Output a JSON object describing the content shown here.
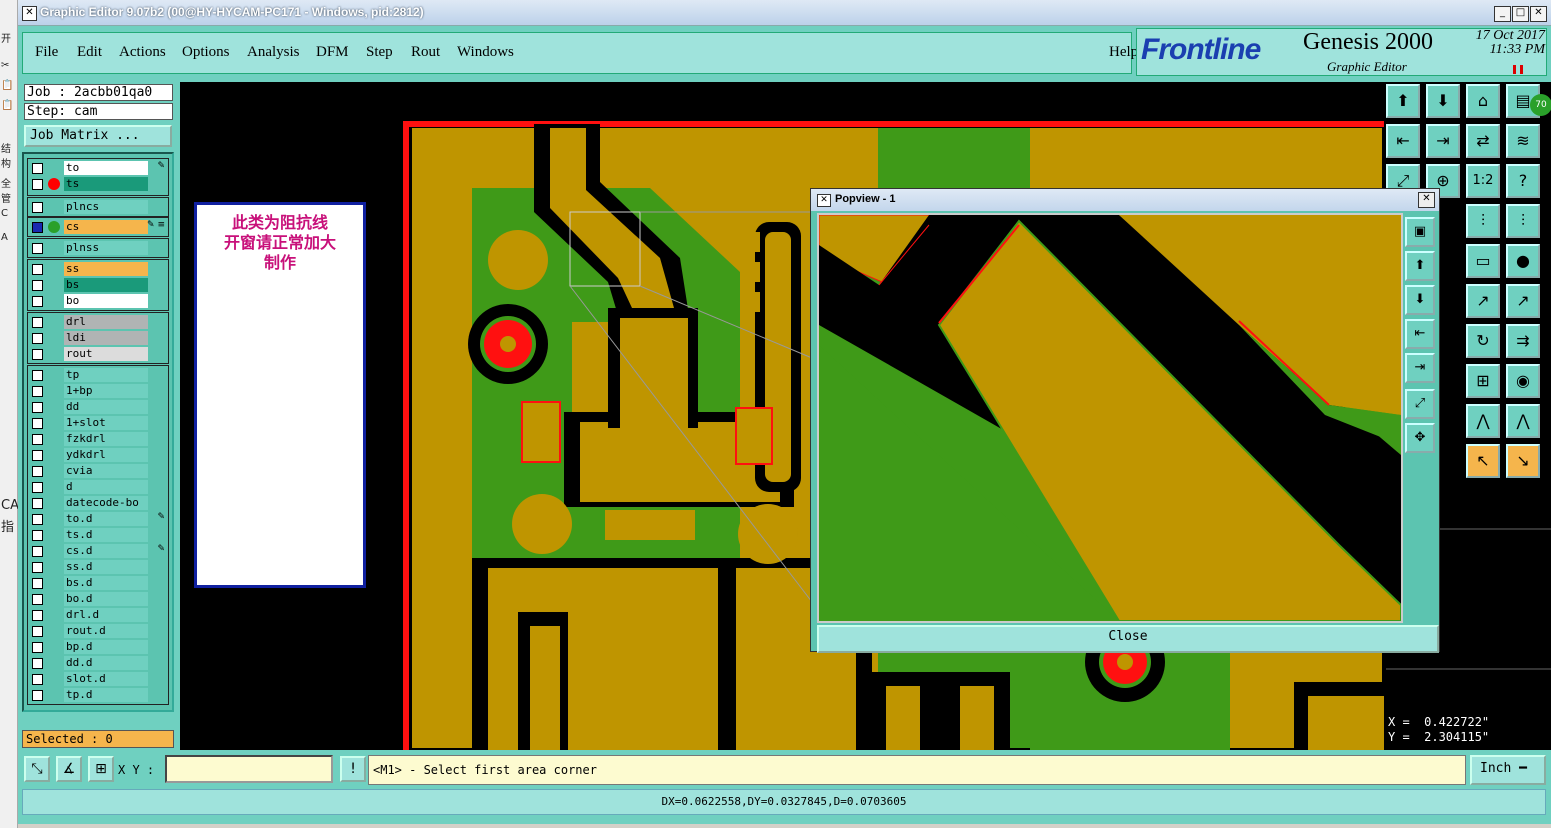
{
  "window": {
    "title": "Graphic Editor 9.07b2 (00@HY-HYCAM-PC171 - Windows, pid:2812)",
    "btn_min": "_",
    "btn_max": "□",
    "btn_close": "✕"
  },
  "left_strip": [
    "开",
    "✂",
    "📋",
    "📋",
    "✓",
    "结构",
    "全管",
    "C",
    "A",
    "CA",
    "指"
  ],
  "menu": [
    "File",
    "Edit",
    "Actions",
    "Options",
    "Analysis",
    "DFM",
    "Step",
    "Rout",
    "Windows"
  ],
  "help": "Help",
  "brand": {
    "logo": "Frontline",
    "product": "Genesis 2000",
    "subtitle": "Graphic Editor",
    "date": "17 Oct 2017",
    "time": "11:33 PM"
  },
  "job": {
    "job_line": "Job : 2acbb01qa0",
    "step_line": "Step: cam",
    "matrix_button": "Job Matrix ..."
  },
  "layers": {
    "group1": [
      {
        "name": "to",
        "color": "#ffffff",
        "active": false,
        "edit": "✎",
        "dot": ""
      },
      {
        "name": "ts",
        "color": "#1a9a7a",
        "active": false,
        "edit": "",
        "dot": "#ff0000"
      }
    ],
    "group2": [
      {
        "name": "plncs",
        "color": "#6fd0c0",
        "edit": ""
      }
    ],
    "group3": [
      {
        "name": "cs",
        "color": "#f5b54c",
        "edit": "✎ ≡",
        "dot": "#2aa02a"
      }
    ],
    "group4": [
      {
        "name": "plnss",
        "color": "#6fd0c0",
        "edit": ""
      }
    ],
    "group5": [
      {
        "name": "ss",
        "color": "#f5b54c"
      },
      {
        "name": "bs",
        "color": "#1a9a7a"
      },
      {
        "name": "bo",
        "color": "#ffffff"
      }
    ],
    "group6": [
      {
        "name": "drl",
        "color": "#b0b4b4"
      },
      {
        "name": "ldi",
        "color": "#b0b4b4"
      },
      {
        "name": "rout",
        "color": "#dcdcdc"
      }
    ],
    "group7": [
      {
        "name": "tp",
        "edit": ""
      },
      {
        "name": "1+bp",
        "edit": ""
      },
      {
        "name": "dd",
        "edit": ""
      },
      {
        "name": "1+slot",
        "edit": ""
      },
      {
        "name": "fzkdrl",
        "edit": ""
      },
      {
        "name": "ydkdrl",
        "edit": ""
      },
      {
        "name": "cvia",
        "edit": ""
      },
      {
        "name": "d",
        "edit": ""
      },
      {
        "name": "datecode-bo",
        "edit": ""
      },
      {
        "name": "to.d",
        "edit": "✎"
      },
      {
        "name": "ts.d",
        "edit": ""
      },
      {
        "name": "cs.d",
        "edit": "✎"
      },
      {
        "name": "ss.d",
        "edit": ""
      },
      {
        "name": "bs.d",
        "edit": ""
      },
      {
        "name": "bo.d",
        "edit": ""
      },
      {
        "name": "drl.d",
        "edit": ""
      },
      {
        "name": "rout.d",
        "edit": ""
      },
      {
        "name": "bp.d",
        "edit": ""
      },
      {
        "name": "dd.d",
        "edit": ""
      },
      {
        "name": "slot.d",
        "edit": ""
      },
      {
        "name": "tp.d",
        "edit": ""
      }
    ]
  },
  "selected": "Selected : 0",
  "note": [
    "此类为阻抗线",
    "开窗请正常加大",
    "制作"
  ],
  "popview": {
    "title": "Popview - 1",
    "close": "Close"
  },
  "coords": {
    "x": "X =  0.422722\"",
    "y": "Y =  2.304115\""
  },
  "bottom": {
    "xy_label": "X Y :",
    "xy_value": "",
    "prompt": "<M1> - Select first area corner",
    "unit": "Inch ━"
  },
  "status": "DX=0.0622558,DY=0.0327845,D=0.0703605",
  "badge": "70",
  "colors": {
    "copper": "#bf9500",
    "laminate": "#3f9a18",
    "mask": "#000000",
    "outline": "#ff1010",
    "panel": "#6fd0c0"
  }
}
